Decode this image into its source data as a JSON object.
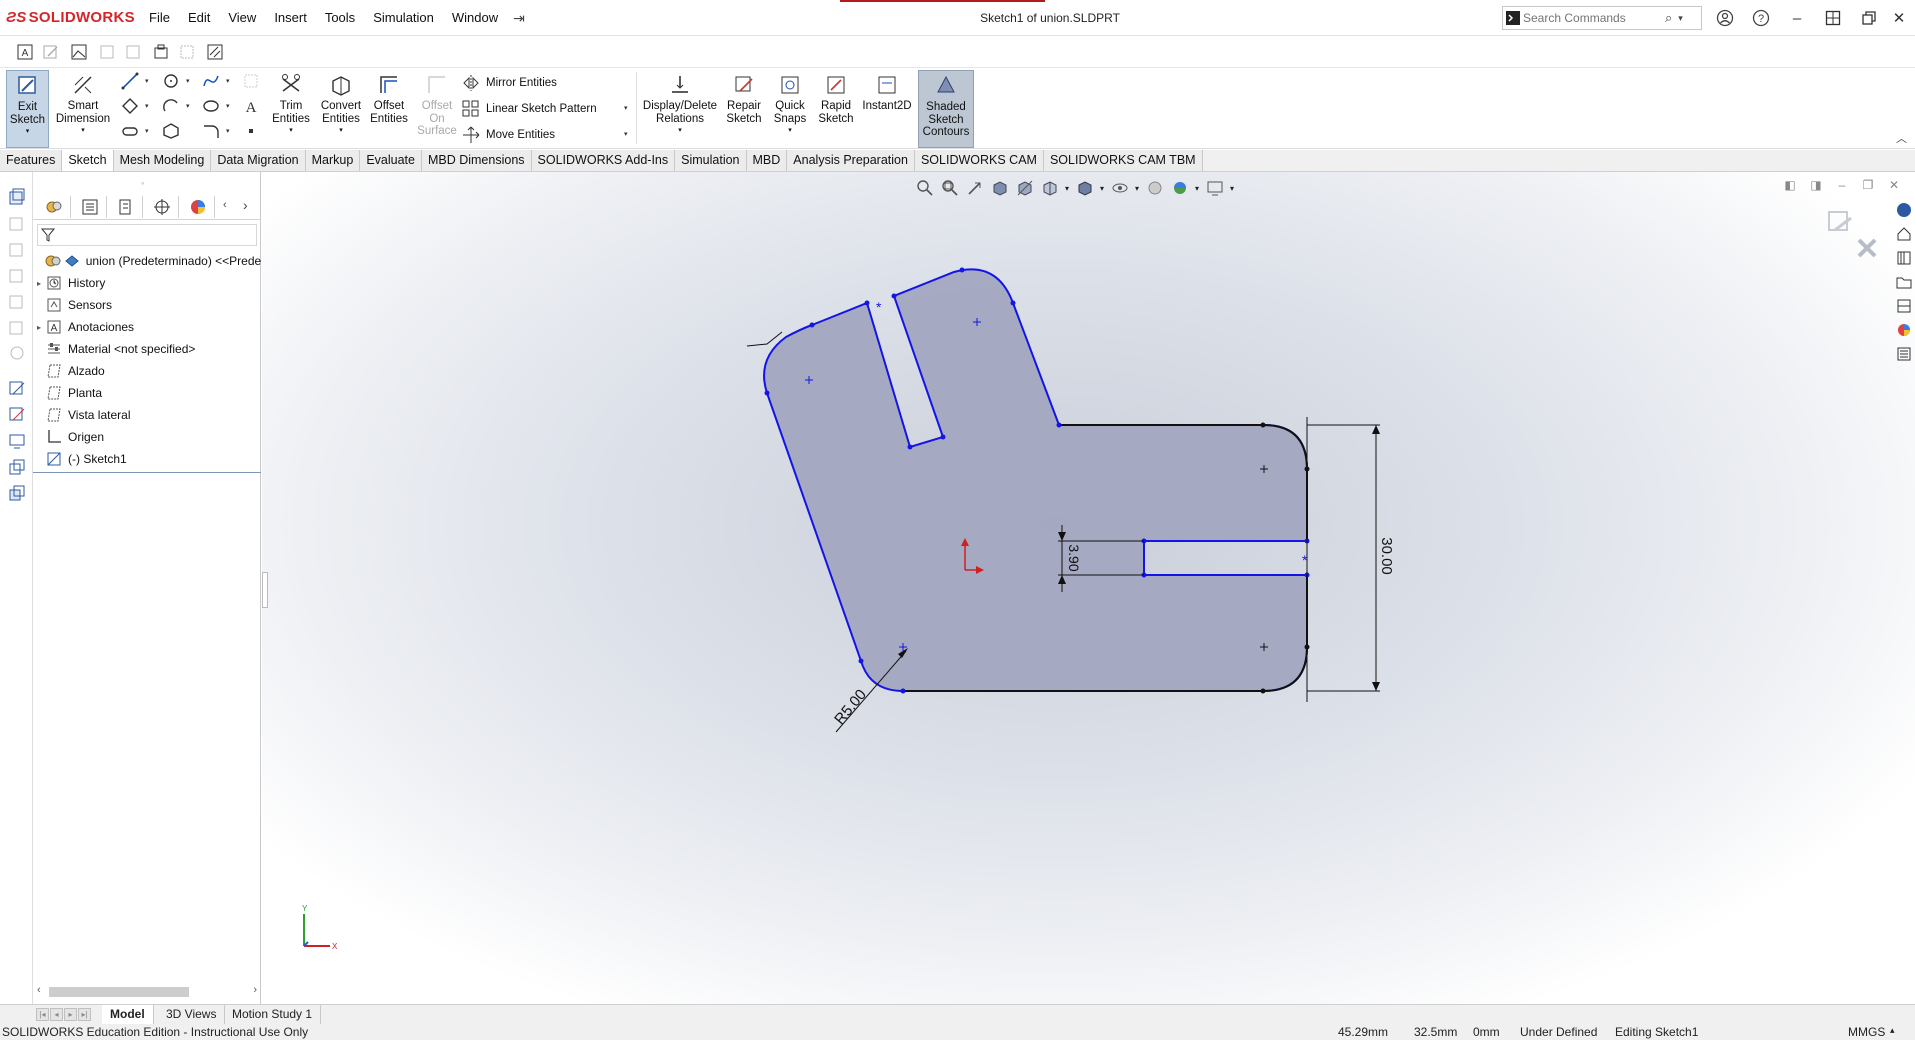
{
  "app": {
    "logo_text": "SOLIDWORKS",
    "accent_color": "#d6252a"
  },
  "menu": [
    "File",
    "Edit",
    "View",
    "Insert",
    "Tools",
    "Simulation",
    "Window"
  ],
  "document_title": "Sketch1 of union.SLDPRT",
  "search": {
    "placeholder": "Search Commands"
  },
  "ribbon": {
    "exit_sketch": "Exit Sketch",
    "smart_dimension": "Smart Dimension",
    "trim_entities": "Trim Entities",
    "convert_entities": "Convert Entities",
    "offset_entities": "Offset Entities",
    "offset_on_surface": "Offset On Surface",
    "mirror_entities": "Mirror Entities",
    "linear_sketch_pattern": "Linear Sketch Pattern",
    "move_entities": "Move Entities",
    "display_delete_relations": "Display/Delete Relations",
    "repair_sketch": "Repair Sketch",
    "quick_snaps": "Quick Snaps",
    "rapid_sketch": "Rapid Sketch",
    "instant2d": "Instant2D",
    "shaded_sketch_contours": "Shaded Sketch Contours"
  },
  "tabs": [
    "Features",
    "Sketch",
    "Mesh Modeling",
    "Data Migration",
    "Markup",
    "Evaluate",
    "MBD Dimensions",
    "SOLIDWORKS Add-Ins",
    "Simulation",
    "MBD",
    "Analysis Preparation",
    "SOLIDWORKS CAM",
    "SOLIDWORKS CAM TBM"
  ],
  "active_tab": "Sketch",
  "feature_tree": {
    "root": "union  (Predeterminado) <<Prede",
    "items": [
      "History",
      "Sensors",
      "Anotaciones",
      "Material <not specified>",
      "Alzado",
      "Planta",
      "Vista lateral",
      "Origen",
      "(-) Sketch1"
    ]
  },
  "sketch": {
    "dim_radius": "R5.00",
    "dim_height": "30.00",
    "dim_slot": "3.90",
    "fill_color": "#a2a6c0",
    "line_color": "#1414e6"
  },
  "bottom_tabs": [
    "Model",
    "3D Views",
    "Motion Study 1"
  ],
  "status": {
    "edition": "SOLIDWORKS Education Edition - Instructional Use Only",
    "x": "45.29mm",
    "y": "32.5mm",
    "z": "0mm",
    "state": "Under Defined",
    "editing": "Editing Sketch1",
    "units": "MMGS"
  }
}
